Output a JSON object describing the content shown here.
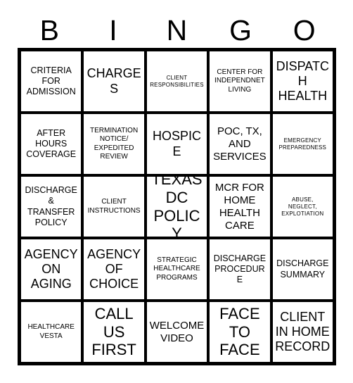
{
  "card": {
    "title": "BINGO",
    "header_letters": [
      "B",
      "I",
      "N",
      "G",
      "O"
    ],
    "grid_size": "5x5",
    "colors": {
      "background": "#ffffff",
      "border": "#000000",
      "text": "#000000",
      "cell_fill": "#ffffff"
    },
    "cells": [
      {
        "text": "CRITERIA\nFOR\nADMISSION",
        "size": "sz-m"
      },
      {
        "text": "CHARGES",
        "size": "sz-xl"
      },
      {
        "text": "CLIENT\nRESPONSIBILITIES",
        "size": "sz-xs"
      },
      {
        "text": "CENTER FOR\nINDEPENDNET\nLIVING",
        "size": "sz-s"
      },
      {
        "text": "DISPATCH\nHEALTH",
        "size": "sz-xl"
      },
      {
        "text": "AFTER\nHOURS\nCOVERAGE",
        "size": "sz-m"
      },
      {
        "text": "TERMINATION\nNOTICE/\nEXPEDITED\nREVIEW",
        "size": "sz-s"
      },
      {
        "text": "HOSPICE",
        "size": "sz-xl"
      },
      {
        "text": "POC, TX,\nAND\nSERVICES",
        "size": "sz-l"
      },
      {
        "text": "EMERGENCY\nPREPAREDNESS",
        "size": "sz-xs"
      },
      {
        "text": "DISCHARGE\n&\nTRANSFER\nPOLICY",
        "size": "sz-m"
      },
      {
        "text": "CLIENT\nINSTRUCTIONS",
        "size": "sz-s"
      },
      {
        "text": "TEXAS\nDC\nPOLICY",
        "size": "sz-xxl"
      },
      {
        "text": "MCR FOR\nHOME\nHEALTH\nCARE",
        "size": "sz-l"
      },
      {
        "text": "ABUSE,\nNEGLECT,\nEXPLOTIATION",
        "size": "sz-xs"
      },
      {
        "text": "AGENCY\nON\nAGING",
        "size": "sz-xl"
      },
      {
        "text": "AGENCY\nOF\nCHOICE",
        "size": "sz-xl"
      },
      {
        "text": "STRATEGIC\nHEALTHCARE\nPROGRAMS",
        "size": "sz-s"
      },
      {
        "text": "DISCHARGE\nPROCEDURE",
        "size": "sz-m"
      },
      {
        "text": "DISCHARGE\nSUMMARY",
        "size": "sz-m"
      },
      {
        "text": "HEALTHCARE\nVESTA",
        "size": "sz-s"
      },
      {
        "text": "CALL\nUS\nFIRST",
        "size": "sz-xxl"
      },
      {
        "text": "WELCOME\nVIDEO",
        "size": "sz-l"
      },
      {
        "text": "FACE\nTO\nFACE",
        "size": "sz-xxl"
      },
      {
        "text": "CLIENT\nIN HOME\nRECORD",
        "size": "sz-xl"
      }
    ]
  }
}
